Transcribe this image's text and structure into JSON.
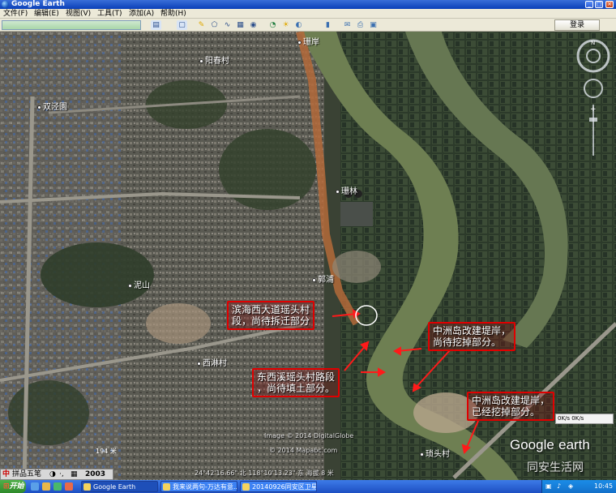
{
  "window": {
    "title": "Google Earth",
    "btn_min": "_",
    "btn_max": "□",
    "btn_close": "×"
  },
  "menu": [
    "文件(F)",
    "编辑(E)",
    "视图(V)",
    "工具(T)",
    "添加(A)",
    "帮助(H)"
  ],
  "toolbar": {
    "login_label": "登录",
    "search_value": ""
  },
  "places": [
    {
      "name": "珊岸"
    },
    {
      "name": "阳春村"
    },
    {
      "name": "双泾園"
    },
    {
      "name": "珊林"
    },
    {
      "name": "郭浦"
    },
    {
      "name": "泥山"
    },
    {
      "name": "西淋村"
    },
    {
      "name": "琐头村"
    }
  ],
  "annotations": [
    {
      "line1": "滨海西大道瑶头村",
      "line2": "段，尚待拆迁部分"
    },
    {
      "line1": "中洲岛改建堤岸，",
      "line2": "尚待挖掉部分。"
    },
    {
      "line1": "东西溪瑶头村路段",
      "line2": "，尚待填土部分。"
    },
    {
      "line1": "中洲岛改建堤岸，",
      "line2": "已经挖掉部分。"
    }
  ],
  "map_info": {
    "copyright1": "Image © 2014 DigitalGlobe",
    "copyright2": "© 2014 Mapabc.com",
    "status": "24°42'16.66\" 北  118°10'13.23\" 东 海拔  8 米",
    "scale": "194 米",
    "logo_a": "Google",
    "logo_b": "earth",
    "net_speed": "0K/s   0K/s",
    "watermark": "同安生活网"
  },
  "ime_bar": {
    "label": "拼品五笔",
    "year": "2003"
  },
  "taskbar": {
    "start_label": "开始",
    "tasks": [
      "Google Earth",
      "我来说两句-万达有意...",
      "20140926同安区卫星..."
    ],
    "clock": "10:45"
  },
  "colors": {
    "annotation_border": "#e00000",
    "river": "#6e7f52",
    "titlebar": "#0a3fb8",
    "taskbar": "#1d4fc2"
  },
  "icons": [
    "earth-icon",
    "start-windows-icon",
    "network-icon",
    "volume-icon",
    "compass-icon",
    "zoom-slider-icon"
  ]
}
